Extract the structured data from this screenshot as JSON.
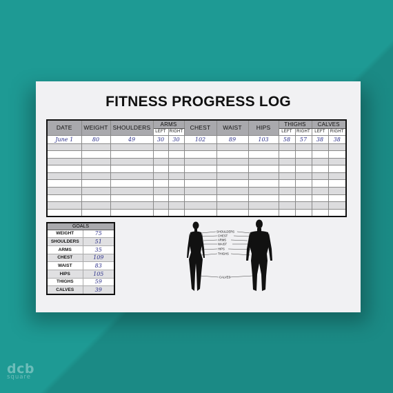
{
  "title": "FITNESS PROGRESS LOG",
  "log": {
    "headers": {
      "date": "DATE",
      "weight": "WEIGHT",
      "shoulders": "SHOULDERS",
      "arms": "ARMS",
      "chest": "CHEST",
      "waist": "WAIST",
      "hips": "HIPS",
      "thighs": "THIGHS",
      "calves": "CALVES",
      "left": "LEFT",
      "right": "RIGHT"
    },
    "rows": [
      {
        "date": "June 1",
        "weight": "80",
        "shoulders": "49",
        "arms_left": "30",
        "arms_right": "30",
        "chest": "102",
        "waist": "89",
        "hips": "103",
        "thighs_left": "58",
        "thighs_right": "57",
        "calves_left": "38",
        "calves_right": "38"
      }
    ]
  },
  "goals": {
    "title": "GOALS",
    "items": [
      {
        "label": "WEIGHT",
        "value": "75"
      },
      {
        "label": "SHOULDERS",
        "value": "51"
      },
      {
        "label": "ARMS",
        "value": "35"
      },
      {
        "label": "CHEST",
        "value": "109"
      },
      {
        "label": "WAIST",
        "value": "83"
      },
      {
        "label": "HIPS",
        "value": "105"
      },
      {
        "label": "THIGHS",
        "value": "59"
      },
      {
        "label": "CALVES",
        "value": "39"
      }
    ]
  },
  "diagram_labels": {
    "shoulders": "SHOULDERS",
    "chest": "CHEST",
    "arms": "ARMS",
    "waist": "WAIST",
    "hips": "HIPS",
    "thighs": "THIGHS",
    "calves": "CALVES"
  },
  "watermark": {
    "main": "dcb",
    "sub": "square"
  },
  "colors": {
    "background": "#1e9a94",
    "paper": "#f1f1f3",
    "header_gray": "#a9a9ad",
    "ink_blue": "#2b2f8a"
  }
}
